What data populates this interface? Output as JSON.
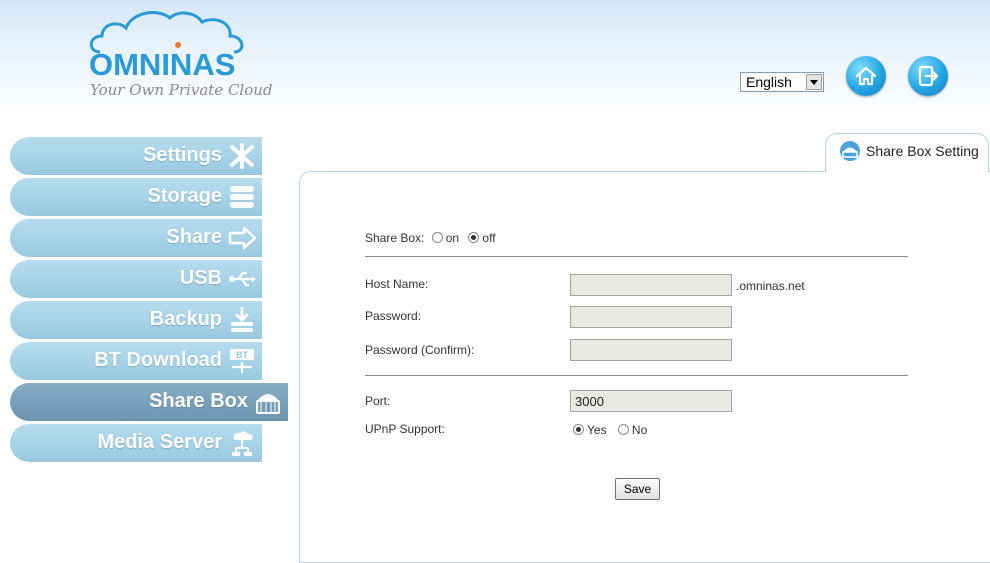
{
  "brand": {
    "name": "OMNINAS",
    "tagline": "Your Own Private Cloud"
  },
  "language": {
    "selected": "English"
  },
  "nav": {
    "items": [
      {
        "label": "Settings",
        "icon": "tools-icon"
      },
      {
        "label": "Storage",
        "icon": "storage-icon"
      },
      {
        "label": "Share",
        "icon": "share-arrow-icon"
      },
      {
        "label": "USB",
        "icon": "usb-icon"
      },
      {
        "label": "Backup",
        "icon": "backup-icon"
      },
      {
        "label": "BT Download",
        "icon": "bt-download-icon"
      },
      {
        "label": "Share Box",
        "icon": "share-box-icon",
        "active": true
      },
      {
        "label": "Media Server",
        "icon": "media-server-icon"
      }
    ]
  },
  "tab": {
    "label": "Share Box Setting"
  },
  "form": {
    "sharebox_label": "Share Box:",
    "sharebox_on": "on",
    "sharebox_off": "off",
    "sharebox_value": "off",
    "hostname_label": "Host Name:",
    "hostname_value": "",
    "hostname_suffix": ".omninas.net",
    "password_label": "Password:",
    "password_confirm_label": "Password (Confirm):",
    "port_label": "Port:",
    "port_value": "3000",
    "upnp_label": "UPnP Support:",
    "upnp_yes": "Yes",
    "upnp_no": "No",
    "upnp_value": "Yes",
    "save_label": "Save"
  }
}
